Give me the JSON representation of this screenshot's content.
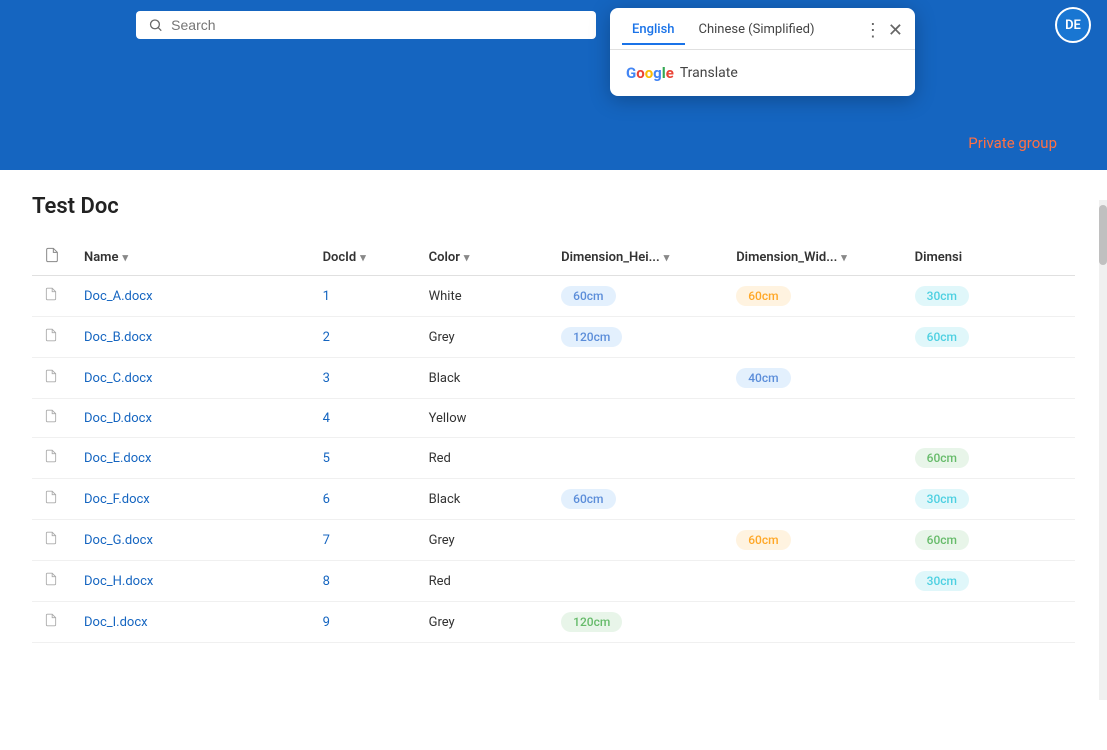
{
  "header": {
    "search_placeholder": "Search",
    "avatar_initials": "DE",
    "background_color": "#1565c0"
  },
  "translate_popup": {
    "tab_english": "English",
    "tab_chinese": "Chinese (Simplified)",
    "google_text": "Google",
    "translate_text": "Translate",
    "is_visible": true
  },
  "banner": {
    "private_group_label": "Private group"
  },
  "page": {
    "title": "Test Doc"
  },
  "table": {
    "columns": [
      {
        "key": "icon",
        "label": ""
      },
      {
        "key": "name",
        "label": "Name",
        "sortable": true
      },
      {
        "key": "docid",
        "label": "DocId",
        "sortable": true
      },
      {
        "key": "color",
        "label": "Color",
        "sortable": true
      },
      {
        "key": "dim_height",
        "label": "Dimension_Hei...",
        "sortable": true
      },
      {
        "key": "dim_width",
        "label": "Dimension_Wid...",
        "sortable": true
      },
      {
        "key": "dimensi",
        "label": "Dimensi",
        "sortable": false
      }
    ],
    "rows": [
      {
        "name": "Doc_A.docx",
        "docid": "1",
        "color": "White",
        "dim_height": "60cm",
        "dim_height_style": "blue",
        "dim_width": "60cm",
        "dim_width_style": "orange",
        "dimensi": "30cm",
        "dimensi_style": "teal"
      },
      {
        "name": "Doc_B.docx",
        "docid": "2",
        "color": "Grey",
        "dim_height": "120cm",
        "dim_height_style": "blue",
        "dim_width": "",
        "dim_width_style": "",
        "dimensi": "60cm",
        "dimensi_style": "teal"
      },
      {
        "name": "Doc_C.docx",
        "docid": "3",
        "color": "Black",
        "dim_height": "",
        "dim_height_style": "",
        "dim_width": "40cm",
        "dim_width_style": "blue",
        "dimensi": "",
        "dimensi_style": ""
      },
      {
        "name": "Doc_D.docx",
        "docid": "4",
        "color": "Yellow",
        "dim_height": "",
        "dim_height_style": "",
        "dim_width": "",
        "dim_width_style": "",
        "dimensi": "",
        "dimensi_style": ""
      },
      {
        "name": "Doc_E.docx",
        "docid": "5",
        "color": "Red",
        "dim_height": "",
        "dim_height_style": "",
        "dim_width": "",
        "dim_width_style": "",
        "dimensi": "60cm",
        "dimensi_style": "green"
      },
      {
        "name": "Doc_F.docx",
        "docid": "6",
        "color": "Black",
        "dim_height": "60cm",
        "dim_height_style": "blue",
        "dim_width": "",
        "dim_width_style": "",
        "dimensi": "30cm",
        "dimensi_style": "teal"
      },
      {
        "name": "Doc_G.docx",
        "docid": "7",
        "color": "Grey",
        "dim_height": "",
        "dim_height_style": "",
        "dim_width": "60cm",
        "dim_width_style": "orange",
        "dimensi": "60cm",
        "dimensi_style": "green"
      },
      {
        "name": "Doc_H.docx",
        "docid": "8",
        "color": "Red",
        "dim_height": "",
        "dim_height_style": "",
        "dim_width": "",
        "dim_width_style": "",
        "dimensi": "30cm",
        "dimensi_style": "teal"
      },
      {
        "name": "Doc_I.docx",
        "docid": "9",
        "color": "Grey",
        "dim_height": "120cm",
        "dim_height_style": "green",
        "dim_width": "",
        "dim_width_style": "",
        "dimensi": "",
        "dimensi_style": ""
      }
    ]
  }
}
